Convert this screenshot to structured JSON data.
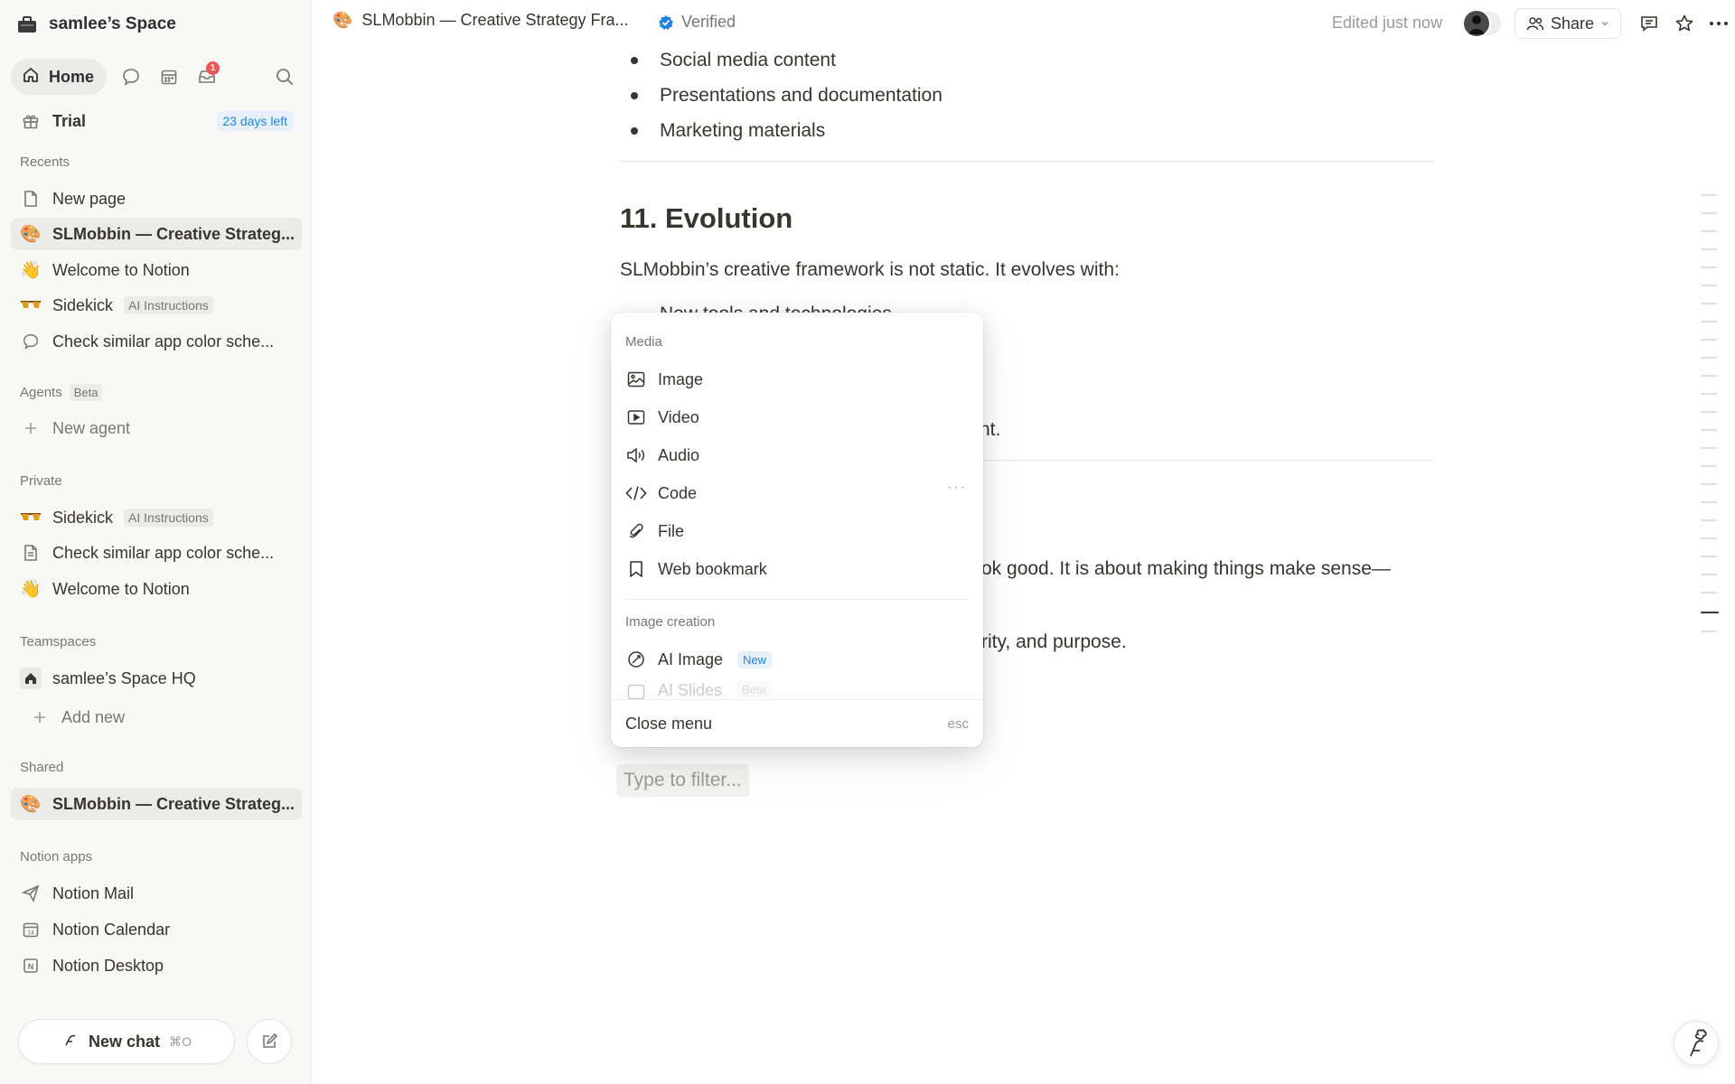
{
  "workspace": {
    "name": "samlee’s Space"
  },
  "top_nav": {
    "home_label": "Home",
    "inbox_badge": "1"
  },
  "trial": {
    "label": "Trial",
    "badge": "23 days left"
  },
  "recents": {
    "label": "Recents",
    "items": [
      {
        "label": "New page",
        "icon": "page-icon"
      },
      {
        "label": "SLMobbin — Creative Strateg...",
        "icon": "palette-icon"
      },
      {
        "label": "Welcome to Notion",
        "icon": "wave-icon"
      },
      {
        "label": "Sidekick",
        "tag": "AI Instructions",
        "icon": "sunglasses-icon"
      },
      {
        "label": "Check similar app color sche...",
        "icon": "chat-bubble-icon"
      }
    ]
  },
  "agents": {
    "label": "Agents",
    "badge": "Beta",
    "new_label": "New agent"
  },
  "private": {
    "label": "Private",
    "items": [
      {
        "label": "Sidekick",
        "tag": "AI Instructions",
        "icon": "sunglasses-icon"
      },
      {
        "label": "Check similar app color sche...",
        "icon": "page-icon"
      },
      {
        "label": "Welcome to Notion",
        "icon": "wave-icon"
      }
    ]
  },
  "teamspaces": {
    "label": "Teamspaces",
    "items": [
      {
        "label": "samlee’s Space HQ",
        "icon": "house-icon"
      }
    ],
    "add_label": "Add new"
  },
  "shared": {
    "label": "Shared",
    "items": [
      {
        "label": "SLMobbin — Creative Strateg...",
        "icon": "palette-icon"
      }
    ]
  },
  "apps": {
    "label": "Notion apps",
    "items": [
      {
        "label": "Notion Mail",
        "icon": "mail-icon"
      },
      {
        "label": "Notion Calendar",
        "icon": "calendar-icon"
      },
      {
        "label": "Notion Desktop",
        "icon": "notion-icon"
      }
    ]
  },
  "new_chat": {
    "label": "New chat",
    "shortcut": "⌘O"
  },
  "topbar": {
    "page_title": "SLMobbin — Creative Strategy Fra...",
    "verified": "Verified",
    "edited": "Edited just now",
    "share": "Share"
  },
  "doc": {
    "bullets_top": [
      "Social media content",
      "Presentations and documentation",
      "Marketing materials"
    ],
    "heading": "11. Evolution",
    "intro": "SLMobbin’s creative framework is not static. It evolves with:",
    "partial_bullet": "New tools and technologies",
    "partial_line_1": "nt.",
    "partial_line_2": "ok good. It is about making things make sense—",
    "partial_line_3": "rity, and purpose."
  },
  "slash_menu": {
    "media_section": "Media",
    "media_items": [
      {
        "label": "Image",
        "icon": "image-icon"
      },
      {
        "label": "Video",
        "icon": "video-icon"
      },
      {
        "label": "Audio",
        "icon": "audio-icon"
      },
      {
        "label": "Code",
        "icon": "code-icon"
      },
      {
        "label": "File",
        "icon": "paperclip-icon"
      },
      {
        "label": "Web bookmark",
        "icon": "bookmark-icon"
      }
    ],
    "image_section": "Image creation",
    "ai_image": {
      "label": "AI Image",
      "tag": "New"
    },
    "faded_item": {
      "label": "AI Slides",
      "tag": "Beta"
    },
    "close_label": "Close menu",
    "close_key": "esc"
  },
  "filter": {
    "placeholder": "Type to filter..."
  },
  "colors": {
    "accent": "#2383e2",
    "badge_red": "#eb5757",
    "sidebar_bg": "#f8f8f7"
  }
}
